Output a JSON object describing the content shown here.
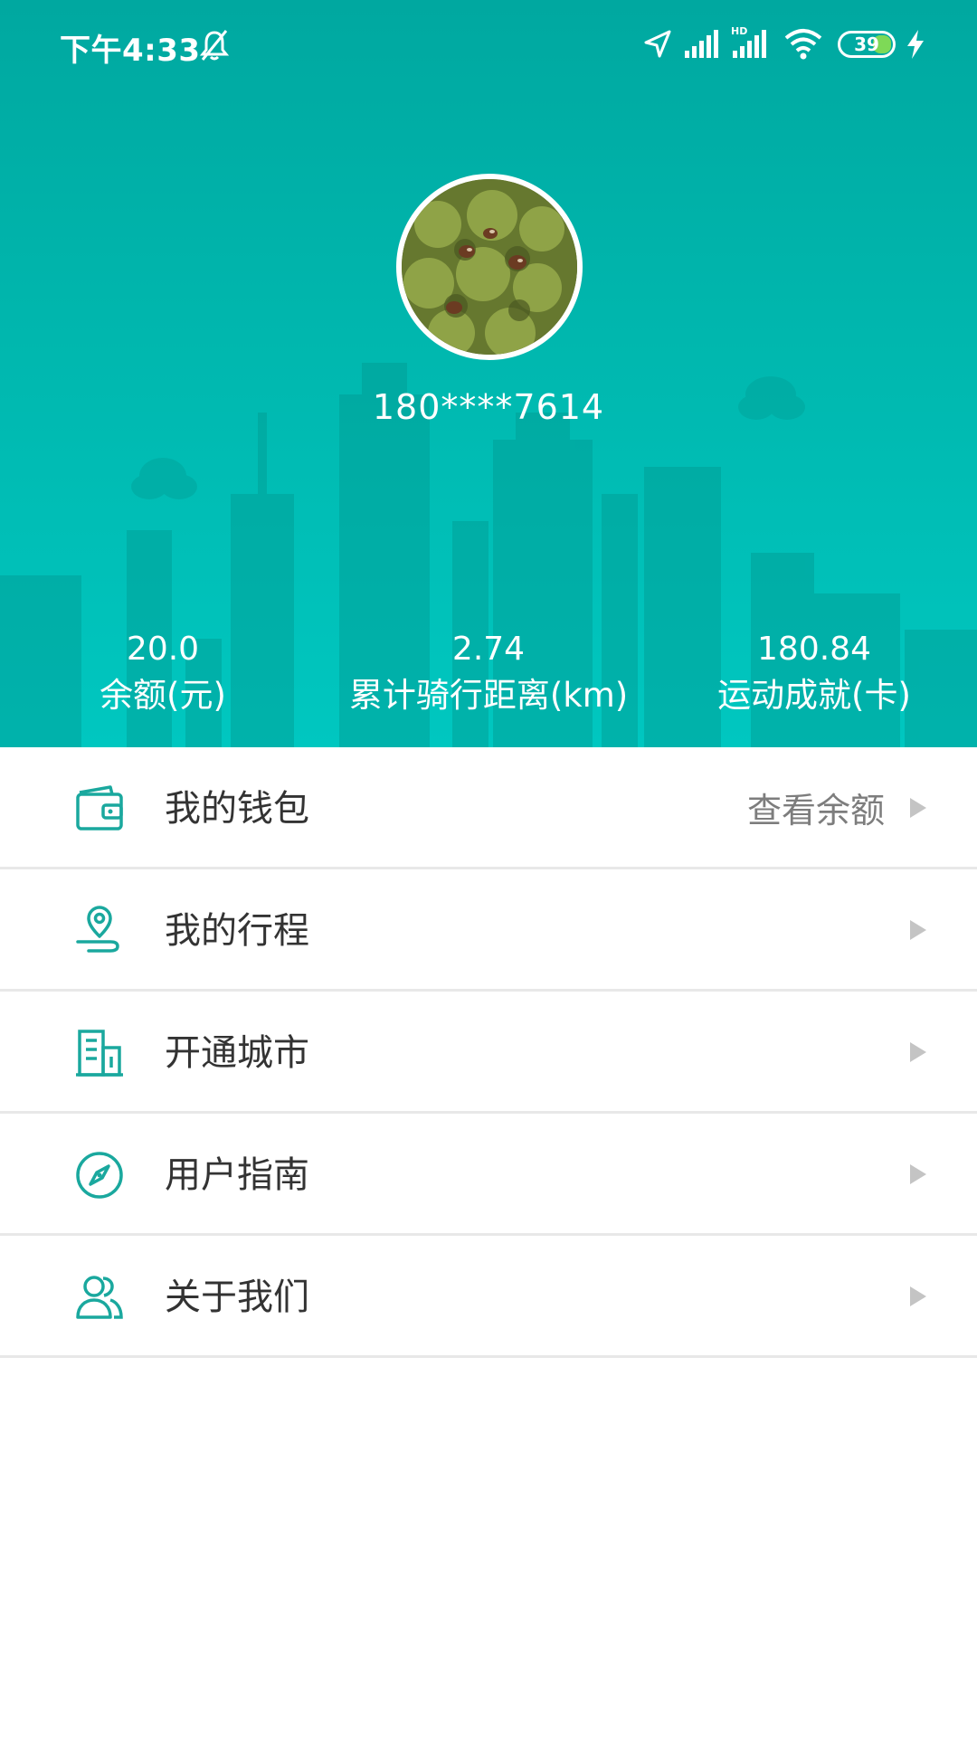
{
  "status_bar": {
    "time": "下午4:33",
    "battery": "39",
    "icons": [
      "mute-bell-icon",
      "location-arrow-icon",
      "signal-icon",
      "hd-signal-icon",
      "wifi-icon",
      "battery-icon",
      "charging-bolt-icon"
    ]
  },
  "profile": {
    "phone": "180****7614"
  },
  "stats": [
    {
      "value": "20.0",
      "label": "余额(元)"
    },
    {
      "value": "2.74",
      "label": "累计骑行距离(km)"
    },
    {
      "value": "180.84",
      "label": "运动成就(卡)"
    }
  ],
  "menu": [
    {
      "label": "我的钱包",
      "extra": "查看余额",
      "icon": "wallet-icon"
    },
    {
      "label": "我的行程",
      "extra": "",
      "icon": "location-trip-icon"
    },
    {
      "label": "开通城市",
      "extra": "",
      "icon": "city-building-icon"
    },
    {
      "label": "用户指南",
      "extra": "",
      "icon": "compass-icon"
    },
    {
      "label": "关于我们",
      "extra": "",
      "icon": "users-icon"
    }
  ],
  "colors": {
    "accent": "#00b2a9",
    "icon": "#1aa89e",
    "text": "#333333",
    "muted": "#7d7d7d"
  }
}
